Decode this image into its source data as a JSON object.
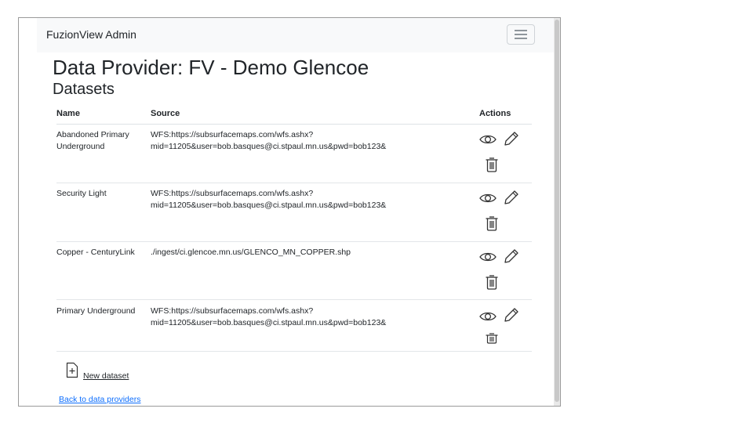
{
  "navbar": {
    "brand": "FuzionView Admin",
    "menu_icon": "hamburger-menu-icon"
  },
  "page": {
    "title": "Data Provider: FV - Demo Glencoe",
    "subtitle": "Datasets"
  },
  "table": {
    "headers": {
      "name": "Name",
      "source": "Source",
      "actions": "Actions"
    },
    "rows": [
      {
        "name_line1": "Abandoned Primary",
        "name_line2": "Underground",
        "source_line1": "WFS:https://subsurfacemaps.com/wfs.ashx?",
        "source_line2": "mid=11205&user=bob.basques@ci.stpaul.mn.us&pwd=bob123&"
      },
      {
        "name_line1": "Security Light",
        "name_line2": "",
        "source_line1": "WFS:https://subsurfacemaps.com/wfs.ashx?",
        "source_line2": "mid=11205&user=bob.basques@ci.stpaul.mn.us&pwd=bob123&"
      },
      {
        "name_line1": "Copper - CenturyLink",
        "name_line2": "",
        "source_line1": "./ingest/ci.glencoe.mn.us/GLENCO_MN_COPPER.shp",
        "source_line2": ""
      },
      {
        "name_line1": "Primary Underground",
        "name_line2": "",
        "source_line1": "WFS:https://subsurfacemaps.com/wfs.ashx?",
        "source_line2": "mid=11205&user=bob.basques@ci.stpaul.mn.us&pwd=bob123&"
      }
    ],
    "action_icons": [
      "eye-icon",
      "pencil-icon",
      "trash-icon"
    ]
  },
  "footer": {
    "new_dataset_label": "New dataset",
    "new_dataset_icon": "file-plus-icon",
    "back_label": "Back to data providers"
  },
  "colors": {
    "navbar_bg": "#f8f9fa",
    "link": "#0d6efd",
    "text": "#212529"
  }
}
